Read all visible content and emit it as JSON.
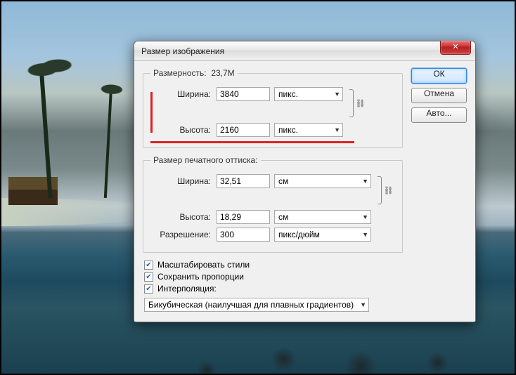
{
  "dialog": {
    "title": "Размер изображения",
    "pixel_group": {
      "legend_prefix": "Размерность:",
      "size_display": "23,7M",
      "width_label": "Ширина:",
      "width_value": "3840",
      "width_unit": "пикс.",
      "height_label": "Высота:",
      "height_value": "2160",
      "height_unit": "пикс."
    },
    "print_group": {
      "legend": "Размер печатного оттиска:",
      "width_label": "Ширина:",
      "width_value": "32,51",
      "width_unit": "см",
      "height_label": "Высота:",
      "height_value": "18,29",
      "height_unit": "см",
      "res_label": "Разрешение:",
      "res_value": "300",
      "res_unit": "пикс/дюйм"
    },
    "checks": {
      "scale_styles": "Масштабировать стили",
      "constrain": "Сохранить пропорции",
      "resample": "Интерполяция:"
    },
    "interpolation_value": "Бикубическая (наилучшая для плавных градиентов)",
    "buttons": {
      "ok": "ОК",
      "cancel": "Отмена",
      "auto": "Авто..."
    }
  }
}
